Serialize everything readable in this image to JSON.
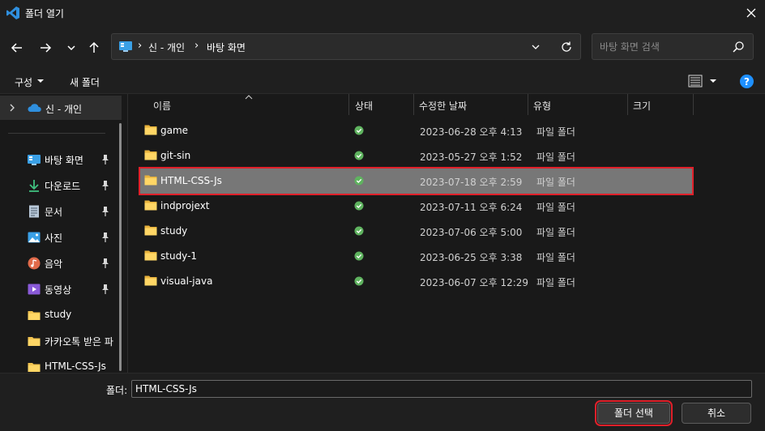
{
  "window": {
    "title": "폴더 열기",
    "app_icon": "vscode-icon",
    "close_icon": "close-icon"
  },
  "navigation": {
    "back_icon": "arrow-left-icon",
    "forward_icon": "arrow-right-icon",
    "recent_icon": "chevron-down-icon",
    "up_icon": "arrow-up-icon"
  },
  "address": {
    "breadcrumbs": [
      "신 - 개인",
      "바탕 화면"
    ],
    "separator": "›",
    "refresh_icon": "refresh-icon"
  },
  "search": {
    "placeholder": "바탕 화면 검색"
  },
  "toolbar": {
    "organize_label": "구성",
    "new_folder_label": "새 폴더",
    "view_icon": "details-view-icon",
    "help_icon": "help-icon"
  },
  "sidebar": {
    "onedrive_label": "신 - 개인",
    "items": [
      {
        "label": "바탕 화면",
        "icon": "desktop-icon",
        "pinned": true
      },
      {
        "label": "다운로드",
        "icon": "download-icon",
        "pinned": true
      },
      {
        "label": "문서",
        "icon": "document-icon",
        "pinned": true
      },
      {
        "label": "사진",
        "icon": "pictures-icon",
        "pinned": true
      },
      {
        "label": "음악",
        "icon": "music-icon",
        "pinned": true
      },
      {
        "label": "동영상",
        "icon": "video-icon",
        "pinned": true
      },
      {
        "label": "study",
        "icon": "folder-icon",
        "pinned": false
      },
      {
        "label": "카카오톡 받은 파",
        "icon": "folder-icon",
        "pinned": false
      },
      {
        "label": "HTML-CSS-Js",
        "icon": "folder-icon",
        "pinned": false
      }
    ]
  },
  "columns": [
    "이름",
    "상태",
    "수정한 날짜",
    "유형",
    "크기"
  ],
  "files": [
    {
      "name": "game",
      "date": "2023-06-28 오후 4:13",
      "type": "파일 폴더",
      "selected": false
    },
    {
      "name": "git-sin",
      "date": "2023-05-27 오후 1:52",
      "type": "파일 폴더",
      "selected": false
    },
    {
      "name": "HTML-CSS-Js",
      "date": "2023-07-18 오후 2:59",
      "type": "파일 폴더",
      "selected": true
    },
    {
      "name": "indprojext",
      "date": "2023-07-11 오후 6:24",
      "type": "파일 폴더",
      "selected": false
    },
    {
      "name": "study",
      "date": "2023-07-06 오후 5:00",
      "type": "파일 폴더",
      "selected": false
    },
    {
      "name": "study-1",
      "date": "2023-06-25 오후 3:38",
      "type": "파일 폴더",
      "selected": false
    },
    {
      "name": "visual-java",
      "date": "2023-06-07 오후 12:29",
      "type": "파일 폴더",
      "selected": false
    }
  ],
  "footer": {
    "folder_label": "폴더:",
    "folder_value": "HTML-CSS-Js",
    "select_button": "폴더 선택",
    "cancel_button": "취소"
  },
  "colors": {
    "selection": "#777777",
    "highlight_box": "#e0202a",
    "folder": "#f2c350",
    "status_ok": "#5fb35f",
    "accent": "#1e90ff"
  }
}
